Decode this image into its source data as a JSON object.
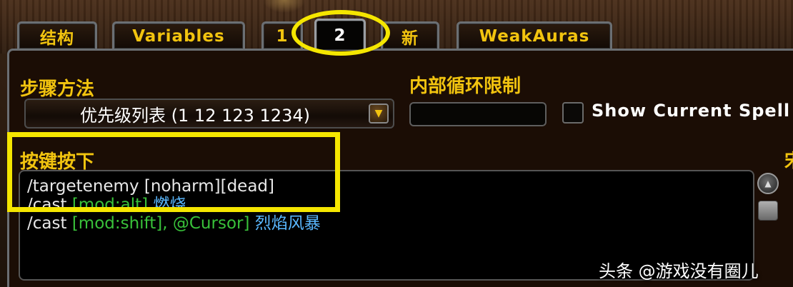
{
  "tabs": [
    {
      "label": "结构",
      "active": false
    },
    {
      "label": "Variables",
      "active": false
    },
    {
      "label": "1",
      "active": false
    },
    {
      "label": "2",
      "active": true
    },
    {
      "label": "新",
      "active": false
    },
    {
      "label": "WeakAuras",
      "active": false
    }
  ],
  "step_method": {
    "label": "步骤方法",
    "selected": "优先级列表 (1 12 123 1234)"
  },
  "inner_loop": {
    "label": "内部循环限制",
    "value": ""
  },
  "show_current_spell": {
    "label": "Show Current Spell",
    "checked": false
  },
  "keypress": {
    "label": "按键按下",
    "lines": [
      [
        {
          "text": "/targetenemy ",
          "color": "white"
        },
        {
          "text": "[noharm][dead]",
          "color": "white"
        }
      ],
      [
        {
          "text": "/cast ",
          "color": "white"
        },
        {
          "text": "[mod:alt] ",
          "color": "green"
        },
        {
          "text": "燃烧",
          "color": "blue"
        }
      ],
      [
        {
          "text": "/cast ",
          "color": "white"
        },
        {
          "text": "[mod:shift], @Cursor] ",
          "color": "green"
        },
        {
          "text": "烈焰风暴",
          "color": "blue"
        }
      ]
    ]
  },
  "right_cut_label": "宋",
  "watermark": "头条 @游戏没有圈儿",
  "colors": {
    "gold": "#f2c40f",
    "highlight": "#f5e600",
    "macro_green": "#39c13a",
    "macro_blue": "#5ab8ff"
  }
}
